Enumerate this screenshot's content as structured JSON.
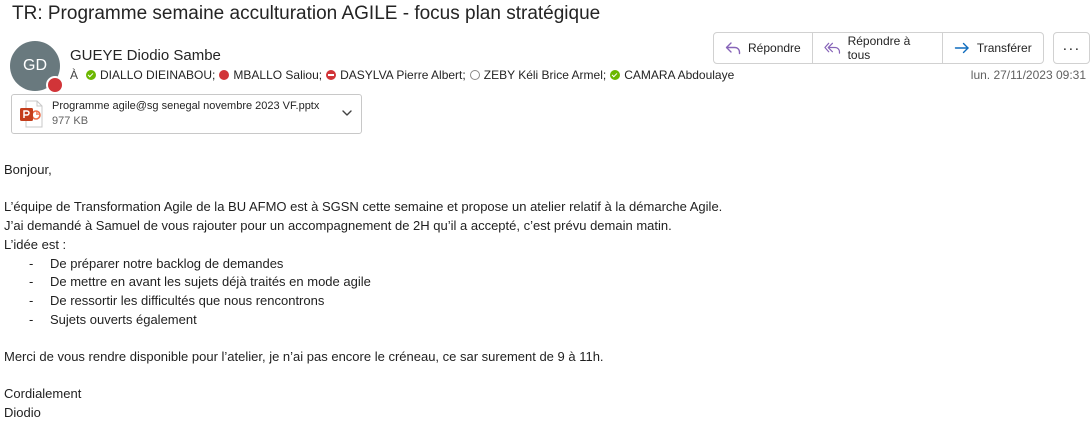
{
  "subject": "TR:  Programme semaine acculturation AGILE - focus plan stratégique",
  "sender": {
    "initials": "GD",
    "name": "GUEYE Diodio Sambe"
  },
  "to_label": "À",
  "recipients": [
    {
      "name": "DIALLO DIEINABOU;",
      "status": "available"
    },
    {
      "name": "MBALLO Saliou;",
      "status": "busy"
    },
    {
      "name": "DASYLVA Pierre Albert;",
      "status": "dnd"
    },
    {
      "name": "ZEBY Kéli Brice Armel;",
      "status": "offline"
    },
    {
      "name": "CAMARA Abdoulaye",
      "status": "available"
    }
  ],
  "actions": {
    "reply": "Répondre",
    "reply_all": "Répondre à tous",
    "forward": "Transférer",
    "more": "···"
  },
  "date": "lun. 27/11/2023 09:31",
  "attachment": {
    "name": "Programme agile@sg senegal novembre 2023 VF.pptx",
    "size": "977 KB",
    "icon": "powerpoint-icon"
  },
  "body": {
    "greeting": "Bonjour,",
    "p1": "L’équipe de Transformation Agile de la BU AFMO est à SGSN cette semaine et propose un atelier relatif à la démarche Agile.",
    "p2": "J’ai demandé à Samuel de vous rajouter pour un accompagnement de 2H qu’il a accepté, c’est prévu demain matin.",
    "p3": "L’idée est :",
    "bullets": [
      "De préparer notre backlog de demandes",
      "De mettre en avant les sujets déjà traités en mode agile",
      "De ressortir les difficultés que nous rencontrons",
      "Sujets ouverts également"
    ],
    "p4": "Merci de vous rendre disponible pour l’atelier, je n’ai pas encore le créneau, ce sar surement de 9 à 11h.",
    "closing": "Cordialement",
    "signature": "Diodio"
  },
  "colors": {
    "accent": "#8764b8",
    "forward_accent": "#0f6cbd",
    "available": "#6bb700",
    "busy": "#d13438",
    "avatar": "#69797e",
    "powerpoint": "#c43e1c"
  }
}
